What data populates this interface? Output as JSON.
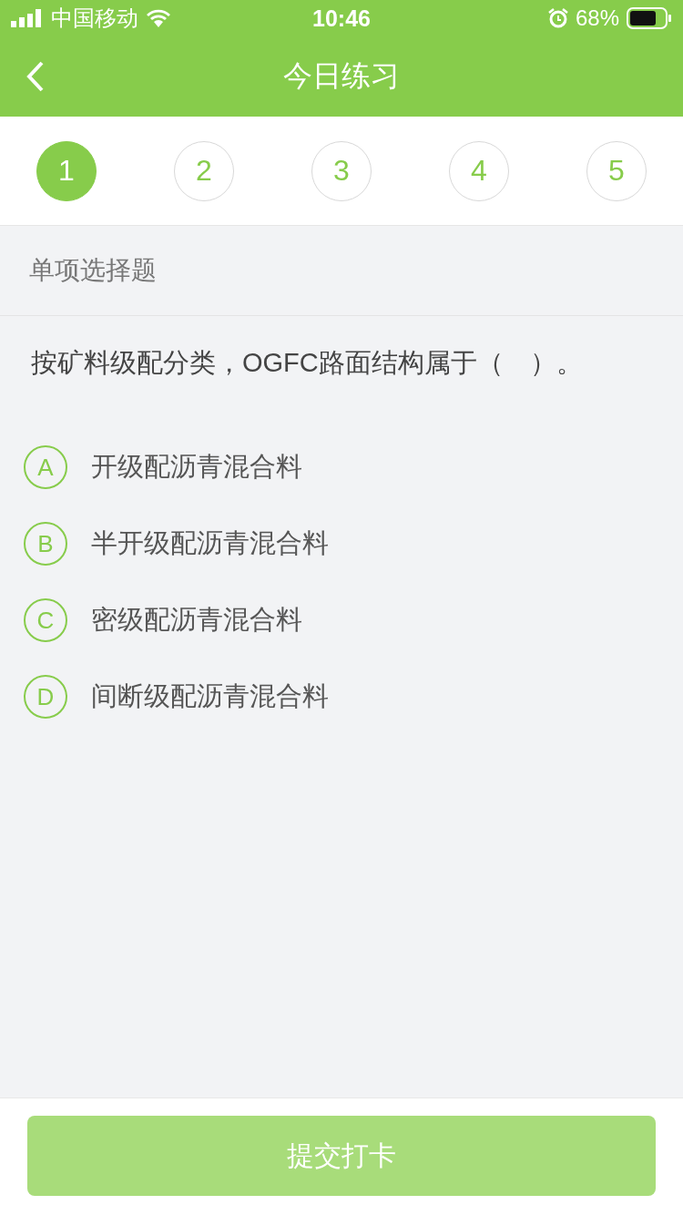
{
  "status_bar": {
    "carrier": "中国移动",
    "time": "10:46",
    "battery": "68%"
  },
  "nav": {
    "title": "今日练习"
  },
  "steps": [
    {
      "label": "1",
      "selected": true
    },
    {
      "label": "2",
      "selected": false
    },
    {
      "label": "3",
      "selected": false
    },
    {
      "label": "4",
      "selected": false
    },
    {
      "label": "5",
      "selected": false
    }
  ],
  "question": {
    "type": "单项选择题",
    "text": "按矿料级配分类，OGFC路面结构属于（　）。",
    "options": [
      {
        "letter": "A",
        "text": "开级配沥青混合料",
        "selected": false
      },
      {
        "letter": "B",
        "text": "半开级配沥青混合料",
        "selected": false
      },
      {
        "letter": "C",
        "text": "密级配沥青混合料",
        "selected": false
      },
      {
        "letter": "D",
        "text": "间断级配沥青混合料",
        "selected": false
      }
    ]
  },
  "submit": {
    "label": "提交打卡",
    "disabled": true
  }
}
